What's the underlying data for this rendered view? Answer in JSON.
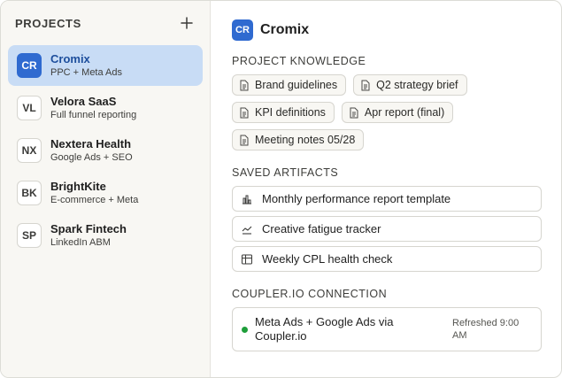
{
  "sidebar": {
    "title": "PROJECTS",
    "add_icon": "plus-icon",
    "projects": [
      {
        "initials": "CR",
        "name": "Cromix",
        "subtitle": "PPC + Meta Ads",
        "active": true
      },
      {
        "initials": "VL",
        "name": "Velora SaaS",
        "subtitle": "Full funnel reporting",
        "active": false
      },
      {
        "initials": "NX",
        "name": "Nextera Health",
        "subtitle": "Google Ads + SEO",
        "active": false
      },
      {
        "initials": "BK",
        "name": "BrightKite",
        "subtitle": "E-commerce + Meta",
        "active": false
      },
      {
        "initials": "SP",
        "name": "Spark Fintech",
        "subtitle": "LinkedIn ABM",
        "active": false
      }
    ]
  },
  "main": {
    "initials": "CR",
    "title": "Cromix",
    "knowledge": {
      "label": "PROJECT KNOWLEDGE",
      "items": [
        "Brand guidelines",
        "Q2 strategy brief",
        "KPI definitions",
        "Apr report (final)",
        "Meeting notes 05/28"
      ]
    },
    "artifacts": {
      "label": "SAVED ARTIFACTS",
      "items": [
        {
          "label": "Monthly performance report template",
          "icon": "bar-chart-icon"
        },
        {
          "label": "Creative fatigue tracker",
          "icon": "trend-line-icon"
        },
        {
          "label": "Weekly CPL health check",
          "icon": "table-icon"
        }
      ]
    },
    "connection": {
      "label": "COUPLER.IO CONNECTION",
      "name": "Meta Ads + Google Ads via Coupler.io",
      "refreshed": "Refreshed 9:00 AM",
      "status_color": "#1e9e3a"
    }
  },
  "colors": {
    "accent": "#2f6ad0",
    "active_bg": "#c8dcf5",
    "sidebar_bg": "#f8f7f3"
  }
}
